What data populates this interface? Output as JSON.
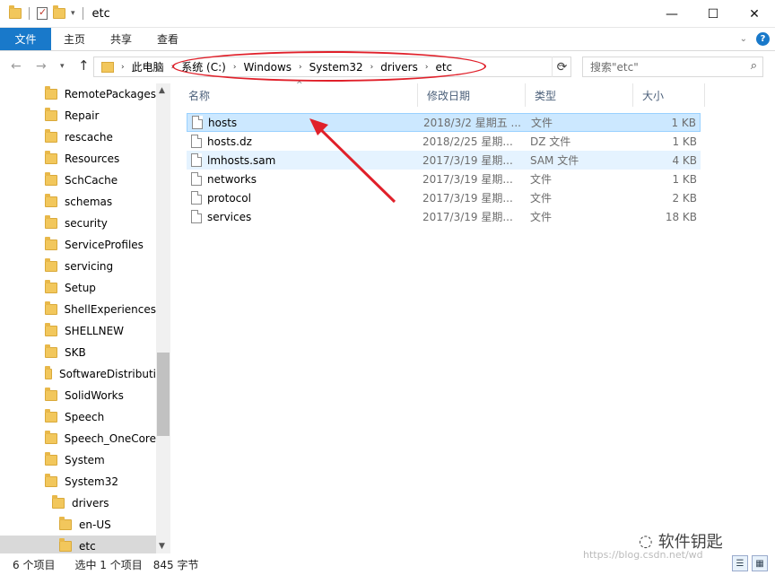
{
  "window": {
    "title": "etc",
    "controls": {
      "minimize": "—",
      "maximize": "☐",
      "close": "✕"
    }
  },
  "ribbon": {
    "tabs": [
      "文件",
      "主页",
      "共享",
      "查看"
    ]
  },
  "address": {
    "crumbs": [
      "此电脑",
      "系统 (C:)",
      "Windows",
      "System32",
      "drivers",
      "etc"
    ],
    "search_placeholder": "搜索\"etc\""
  },
  "nav_pane": {
    "items": [
      "RemotePackages",
      "Repair",
      "rescache",
      "Resources",
      "SchCache",
      "schemas",
      "security",
      "ServiceProfiles",
      "servicing",
      "Setup",
      "ShellExperiences",
      "SHELLNEW",
      "SKB",
      "SoftwareDistributi",
      "SolidWorks",
      "Speech",
      "Speech_OneCore",
      "System",
      "System32",
      "drivers",
      "en-US",
      "etc"
    ],
    "selected": "etc"
  },
  "columns": {
    "name": "名称",
    "date": "修改日期",
    "type": "类型",
    "size": "大小"
  },
  "files": [
    {
      "name": "hosts",
      "date": "2018/3/2 星期五 ...",
      "type": "文件",
      "size": "1 KB"
    },
    {
      "name": "hosts.dz",
      "date": "2018/2/25 星期...",
      "type": "DZ 文件",
      "size": "1 KB"
    },
    {
      "name": "lmhosts.sam",
      "date": "2017/3/19 星期...",
      "type": "SAM 文件",
      "size": "4 KB"
    },
    {
      "name": "networks",
      "date": "2017/3/19 星期...",
      "type": "文件",
      "size": "1 KB"
    },
    {
      "name": "protocol",
      "date": "2017/3/19 星期...",
      "type": "文件",
      "size": "2 KB"
    },
    {
      "name": "services",
      "date": "2017/3/19 星期...",
      "type": "文件",
      "size": "18 KB"
    }
  ],
  "status": {
    "count": "6 个项目",
    "selection": "选中 1 个项目",
    "size": "845 字节"
  },
  "watermark": {
    "label": "软件钥匙",
    "url": "https://blog.csdn.net/wd"
  },
  "colors": {
    "accent": "#1979ca",
    "annotation": "#e0202a",
    "selection": "#cce8ff"
  }
}
